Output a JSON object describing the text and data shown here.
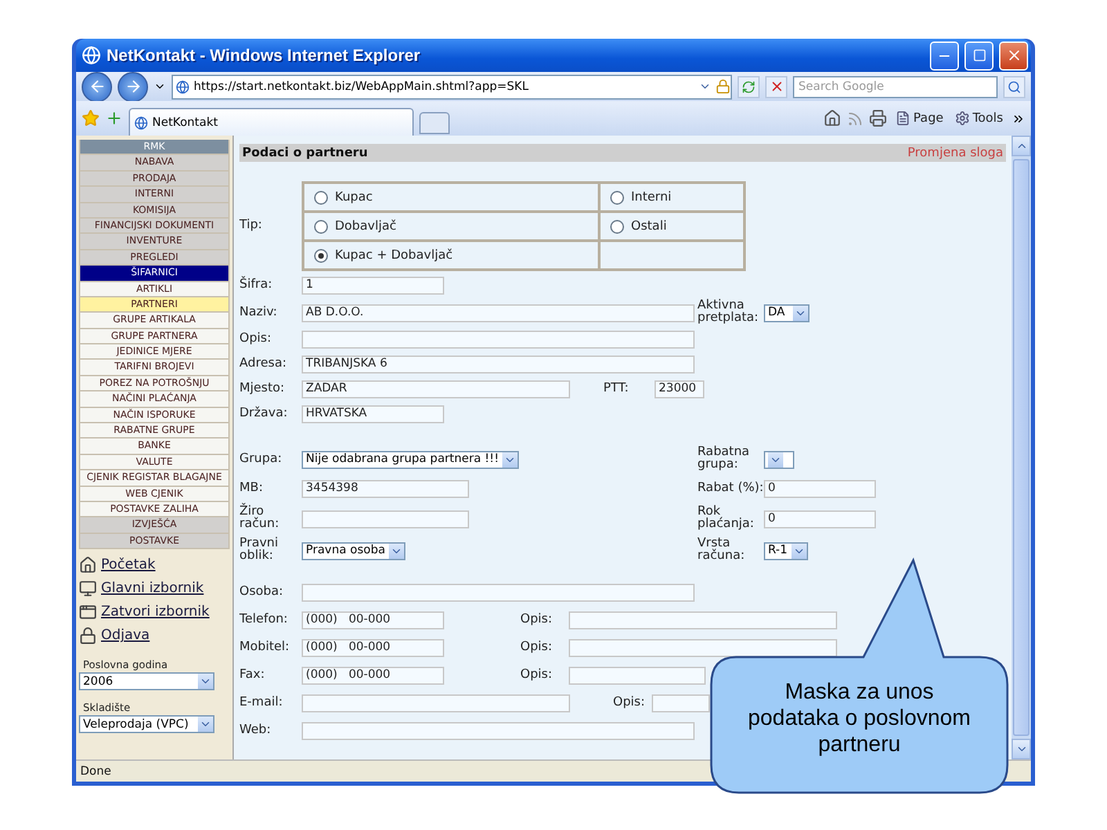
{
  "window": {
    "title": "NetKontakt - Windows Internet Explorer"
  },
  "address_bar": {
    "url": "https://start.netkontakt.biz/WebAppMain.shtml?app=SKL",
    "search_placeholder": "Search Google"
  },
  "tabs": [
    {
      "label": "NetKontakt",
      "selected": true
    }
  ],
  "command_bar": [
    "Page",
    "Tools"
  ],
  "sidebar": {
    "menu": [
      {
        "label": "RMK",
        "kind": "header",
        "selected": false
      },
      {
        "label": "NABAVA",
        "kind": "section",
        "selected": false
      },
      {
        "label": "PRODAJA",
        "kind": "section",
        "selected": false
      },
      {
        "label": "INTERNI",
        "kind": "section",
        "selected": false
      },
      {
        "label": "KOMISIJA",
        "kind": "section",
        "selected": false
      },
      {
        "label": "FINANCIJSKI DOKUMENTI",
        "kind": "section",
        "selected": false
      },
      {
        "label": "INVENTURE",
        "kind": "section",
        "selected": false
      },
      {
        "label": "PREGLEDI",
        "kind": "section",
        "selected": false
      },
      {
        "label": "ŠIFARNICI",
        "kind": "section",
        "selected": true
      },
      {
        "label": "ARTIKLI",
        "kind": "item",
        "selected": false
      },
      {
        "label": "PARTNERI",
        "kind": "item",
        "selected": true
      },
      {
        "label": "GRUPE ARTIKALA",
        "kind": "item",
        "selected": false
      },
      {
        "label": "GRUPE PARTNERA",
        "kind": "item",
        "selected": false
      },
      {
        "label": "JEDINICE MJERE",
        "kind": "item",
        "selected": false
      },
      {
        "label": "TARIFNI BROJEVI",
        "kind": "item",
        "selected": false
      },
      {
        "label": "POREZ NA POTROŠNJU",
        "kind": "item",
        "selected": false
      },
      {
        "label": "NAČINI PLAĆANJA",
        "kind": "item",
        "selected": false
      },
      {
        "label": "NAČIN ISPORUKE",
        "kind": "item",
        "selected": false
      },
      {
        "label": "RABATNE GRUPE",
        "kind": "item",
        "selected": false
      },
      {
        "label": "BANKE",
        "kind": "item",
        "selected": false
      },
      {
        "label": "VALUTE",
        "kind": "item",
        "selected": false
      },
      {
        "label": "CJENIK REGISTAR BLAGAJNE",
        "kind": "item",
        "selected": false
      },
      {
        "label": "WEB CJENIK",
        "kind": "item",
        "selected": false
      },
      {
        "label": "POSTAVKE ZALIHA",
        "kind": "item",
        "selected": false
      },
      {
        "label": "IZVJEŠĆA",
        "kind": "section",
        "selected": false
      },
      {
        "label": "POSTAVKE",
        "kind": "section",
        "selected": false
      }
    ],
    "links": [
      "Početak",
      "Glavni izbornik",
      "Zatvori izbornik",
      "Odjava"
    ],
    "selects": [
      {
        "label": "Poslovna godina",
        "value": "2006"
      },
      {
        "label": "Skladište",
        "value": "Veleprodaja (VPC)"
      }
    ]
  },
  "form": {
    "title": "Podaci o partneru",
    "mode": "Promjena sloga",
    "type_label": "Tip:",
    "types": [
      {
        "label": "Kupac",
        "selected": false
      },
      {
        "label": "Interni",
        "selected": false
      },
      {
        "label": "Dobavljač",
        "selected": false
      },
      {
        "label": "Ostali",
        "selected": false
      },
      {
        "label": "Kupac + Dobavljač",
        "selected": true
      }
    ],
    "groups": [
      [
        {
          "label": "Šifra:",
          "kind": "input",
          "value": "1"
        },
        {
          "label": "Naziv:",
          "kind": "input",
          "value": "AB D.O.O.",
          "right": {
            "label": "Aktivna pretplata:",
            "kind": "select",
            "value": "DA"
          }
        },
        {
          "label": "Opis:",
          "kind": "input"
        },
        {
          "label": "Adresa:",
          "kind": "input",
          "value": "TRIBANJSKA 6"
        },
        {
          "label": "Mjesto:",
          "kind": "input",
          "value": "ZADAR",
          "right": {
            "label": "PTT:",
            "kind": "input",
            "value": "23000"
          }
        },
        {
          "label": "Država:",
          "kind": "input",
          "value": "HRVATSKA"
        }
      ],
      [
        {
          "label": "Grupa:",
          "kind": "select",
          "value": "Nije odabrana grupa partnera !!!",
          "right": {
            "label": "Rabatna grupa:",
            "kind": "select"
          }
        },
        {
          "label": "MB:",
          "kind": "input",
          "value": "3454398",
          "right": {
            "label": "Rabat (%):",
            "kind": "input",
            "value": "0"
          }
        },
        {
          "label": "Žiro račun:",
          "kind": "input",
          "right": {
            "label": "Rok plaćanja:",
            "kind": "input",
            "value": "0"
          }
        },
        {
          "label": "Pravni oblik:",
          "kind": "select",
          "value": "Pravna osoba",
          "right": {
            "label": "Vrsta računa:",
            "kind": "select",
            "value": "R-1"
          }
        }
      ],
      [
        {
          "label": "Osoba:",
          "kind": "input"
        },
        {
          "label": "Telefon:",
          "kind": "input",
          "value": "(000)   00-000",
          "right": {
            "label": "Opis:",
            "kind": "input"
          }
        },
        {
          "label": "Mobitel:",
          "kind": "input",
          "value": "(000)   00-000",
          "right": {
            "label": "Opis:",
            "kind": "input"
          }
        },
        {
          "label": "Fax:",
          "kind": "input",
          "value": "(000)   00-000",
          "right": {
            "label": "Opis:",
            "kind": "input"
          }
        },
        {
          "label": "E-mail:",
          "kind": "input",
          "right": {
            "label": "Opis:",
            "kind": "input"
          }
        },
        {
          "label": "Web:",
          "kind": "input"
        }
      ]
    ]
  },
  "status_bar": "Done",
  "callout": "Maska za unos podataka o poslovnom partneru"
}
